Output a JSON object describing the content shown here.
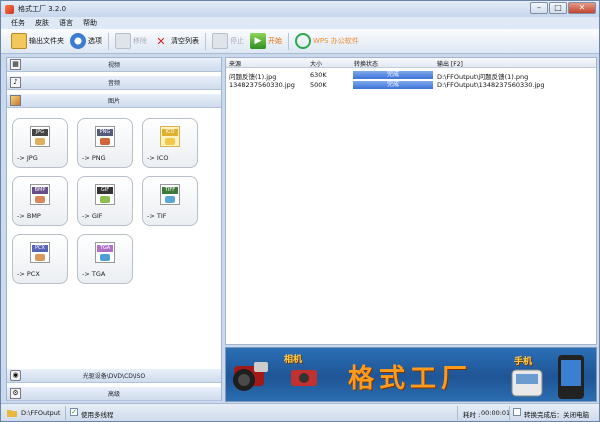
{
  "window": {
    "title": "格式工厂  3.2.0"
  },
  "menu": [
    "任务",
    "皮肤",
    "语言",
    "帮助"
  ],
  "toolbar": {
    "output_folder": "输出文件夹",
    "options": "选项",
    "remove": "移除",
    "clear_list": "清空列表",
    "stop": "停止",
    "start": "开始",
    "wps": "WPS 办公软件"
  },
  "categories": {
    "video": "视频",
    "audio": "音频",
    "image": "图片",
    "rom": "光驱设备\\DVD\\CD\\ISO",
    "advanced": "高级"
  },
  "formats": [
    {
      "label": "-> JPG",
      "tag": "JPG"
    },
    {
      "label": "-> PNG",
      "tag": "PNG"
    },
    {
      "label": "-> ICO",
      "tag": "ICO"
    },
    {
      "label": "-> BMP",
      "tag": "BMP"
    },
    {
      "label": "-> GIF",
      "tag": "GIF"
    },
    {
      "label": "-> TIF",
      "tag": "TIFF"
    },
    {
      "label": "-> PCX",
      "tag": "PCX"
    },
    {
      "label": "-> TGA",
      "tag": "TGA"
    }
  ],
  "table": {
    "headers": {
      "source": "来源",
      "size": "大小",
      "status": "转换状态",
      "output": "输出 [F2]"
    },
    "rows": [
      {
        "source": "问题反馈(1).jpg",
        "size": "630K",
        "status": "完成",
        "output": "D:\\FFOutput\\问题反馈(1).png"
      },
      {
        "source": "1348237560330.jpg",
        "size": "500K",
        "status": "完成",
        "output": "D:\\FFOutput\\1348237560330.jpg"
      }
    ]
  },
  "banner": {
    "title": "格式工厂",
    "camera_caption": "相机",
    "phone_caption": "手机"
  },
  "status": {
    "output_path": "D:\\FFOutput",
    "multithread": "使用多线程",
    "elapsed_label": "耗时 :",
    "elapsed": "00:00:01",
    "after_convert": "转换完成后：关闭电脑"
  }
}
